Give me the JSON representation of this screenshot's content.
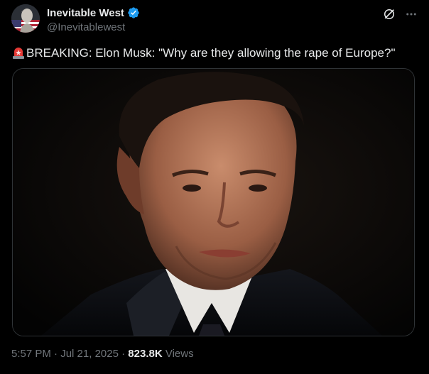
{
  "author": {
    "display_name": "Inevitable West",
    "handle": "@Inevitablewest",
    "verified_color": "#1d9bf0"
  },
  "icons": {
    "verified": "verified-badge-icon",
    "grok": "grok-icon",
    "more": "more-options-icon",
    "emoji": "police-light-emoji"
  },
  "tweet": {
    "text": "BREAKING: Elon Musk: \"Why are they allowing the rape of Europe?\""
  },
  "meta": {
    "time": "5:57 PM",
    "separator1": "·",
    "date": "Jul 21, 2025",
    "separator2": "·",
    "views_count": "823.8K",
    "views_label": "Views"
  },
  "colors": {
    "background": "#000000",
    "text_primary": "#e7e9ea",
    "text_secondary": "#71767b",
    "border": "#2f3336"
  }
}
